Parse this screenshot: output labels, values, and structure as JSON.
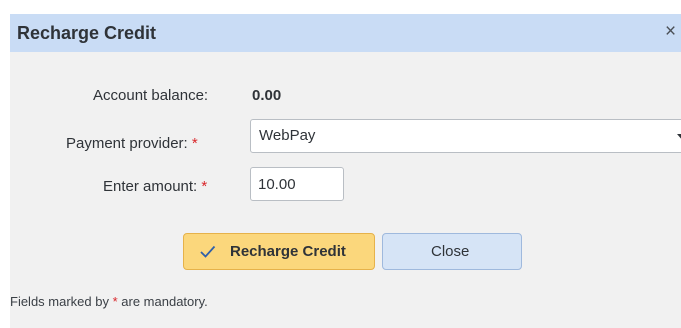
{
  "dialog": {
    "title": "Recharge Credit",
    "close_icon_glyph": "×",
    "required_marker": "*"
  },
  "balance": {
    "label": "Account balance:",
    "value": "0.00"
  },
  "payment_provider": {
    "label": "Payment provider:",
    "selected": "WebPay"
  },
  "amount": {
    "label": "Enter amount:",
    "value": "10.00"
  },
  "buttons": {
    "recharge_label": "Recharge Credit",
    "close_label": "Close"
  },
  "footer": {
    "before": "Fields marked by ",
    "marker": "*",
    "after": " are mandatory."
  },
  "colors": {
    "titlebar": "#c9dcf5",
    "dialog_bg": "#f1f1f1",
    "primary_button": "#fbd77c",
    "secondary_button": "#d6e4f6",
    "required": "#d9262a"
  },
  "icons": {
    "recharge": "check-icon",
    "close": "close-icon",
    "dropdown": "chevron-down-icon"
  }
}
